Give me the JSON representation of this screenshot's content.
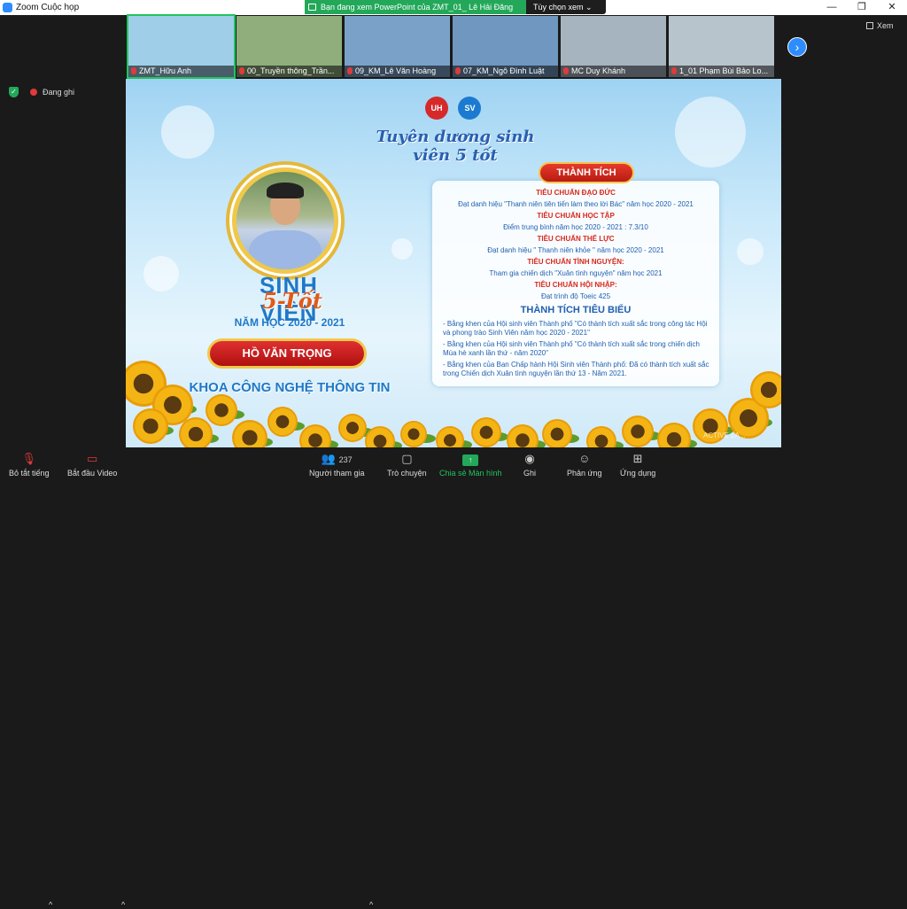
{
  "window": {
    "title": "Zoom Cuộc họp",
    "min": "—",
    "max": "❐",
    "close": "✕"
  },
  "sharebar": {
    "text": "Bạn đang xem PowerPoint của ZMT_01_ Lê Hải Đăng",
    "options": "Tùy chọn xem ⌄"
  },
  "participants": [
    {
      "name": "ZMT_Hữu Anh",
      "color": "#9fcfe8"
    },
    {
      "name": "00_Truyền thông_Trần...",
      "color": "#8fae7c"
    },
    {
      "name": "09_KM_Lê Văn Hoàng",
      "color": "#7aa2c8"
    },
    {
      "name": "07_KM_Ngô Đình Luật",
      "color": "#6f97bf"
    },
    {
      "name": "MC Duy Khánh",
      "color": "#a6b4c0"
    },
    {
      "name": "1_01 Phạm Bùi Bảo Lo...",
      "color": "#b8c4cc"
    }
  ],
  "next_symbol": "›",
  "view_label": "Xem",
  "security_symbol": "✓",
  "recording_label": "Đang ghi",
  "slide": {
    "logo1": "UH",
    "logo2": "SV",
    "title": "Tuyên dương sinh viên 5 tốt",
    "sv_line1": "SINH VIÊN",
    "sv_line2": "5-Tốt",
    "year": "NĂM HỌC 2020 - 2021",
    "student_name": "HỒ VĂN TRỌNG",
    "faculty": "KHOA CÔNG NGHỆ THÔNG TIN",
    "achievements_title": "THÀNH TÍCH",
    "criteria": [
      {
        "heading": "TIÊU CHUẨN ĐẠO ĐỨC",
        "text": "Đạt danh hiệu \"Thanh niên tiên tiến làm theo lời Bác\" năm học 2020 - 2021"
      },
      {
        "heading": "TIÊU CHUẨN HỌC TẬP",
        "text": "Điểm trung bình năm học 2020 - 2021 : 7.3/10"
      },
      {
        "heading": "TIÊU CHUẨN THỂ LỰC",
        "text": "Đạt danh hiệu \" Thanh niên khỏe \" năm học 2020 - 2021"
      },
      {
        "heading": "TIÊU CHUẨN TÌNH NGUYỆN:",
        "text": "Tham gia chiến dịch \"Xuân tình nguyện\" năm học 2021"
      },
      {
        "heading": "TIÊU CHUẨN HỘI NHẬP:",
        "text": "Đạt trình độ Toeic 425"
      }
    ],
    "notable_title": "THÀNH TÍCH TIÊU BIỂU",
    "notable": [
      "- Bằng khen của Hội sinh viên Thành phố \"Có thành tích xuất sắc trong công tác Hội và phong trào Sinh Viên năm học 2020 - 2021\"",
      "- Bằng khen của Hội sinh viên Thành phố \"Có thành tích xuất sắc trong chiến dịch Mùa hè xanh lần thứ - năm 2020\"",
      "- Bằng khen của Ban Chấp hành Hội Sinh viên Thành phố: Đã có thành tích xuất sắc trong Chiến dịch Xuân tình nguyện lần thứ 13 - Năm 2021."
    ],
    "watermark": "ACTIVE LA..."
  },
  "toolbar": {
    "mute": "Bỏ tắt tiếng",
    "video": "Bắt đầu Video",
    "participants": "Người tham gia",
    "participant_count": "237",
    "chat": "Trò chuyện",
    "share": "Chia sẻ Màn hình",
    "record": "Ghi",
    "reactions": "Phản ứng",
    "apps": "Ứng dụng"
  }
}
